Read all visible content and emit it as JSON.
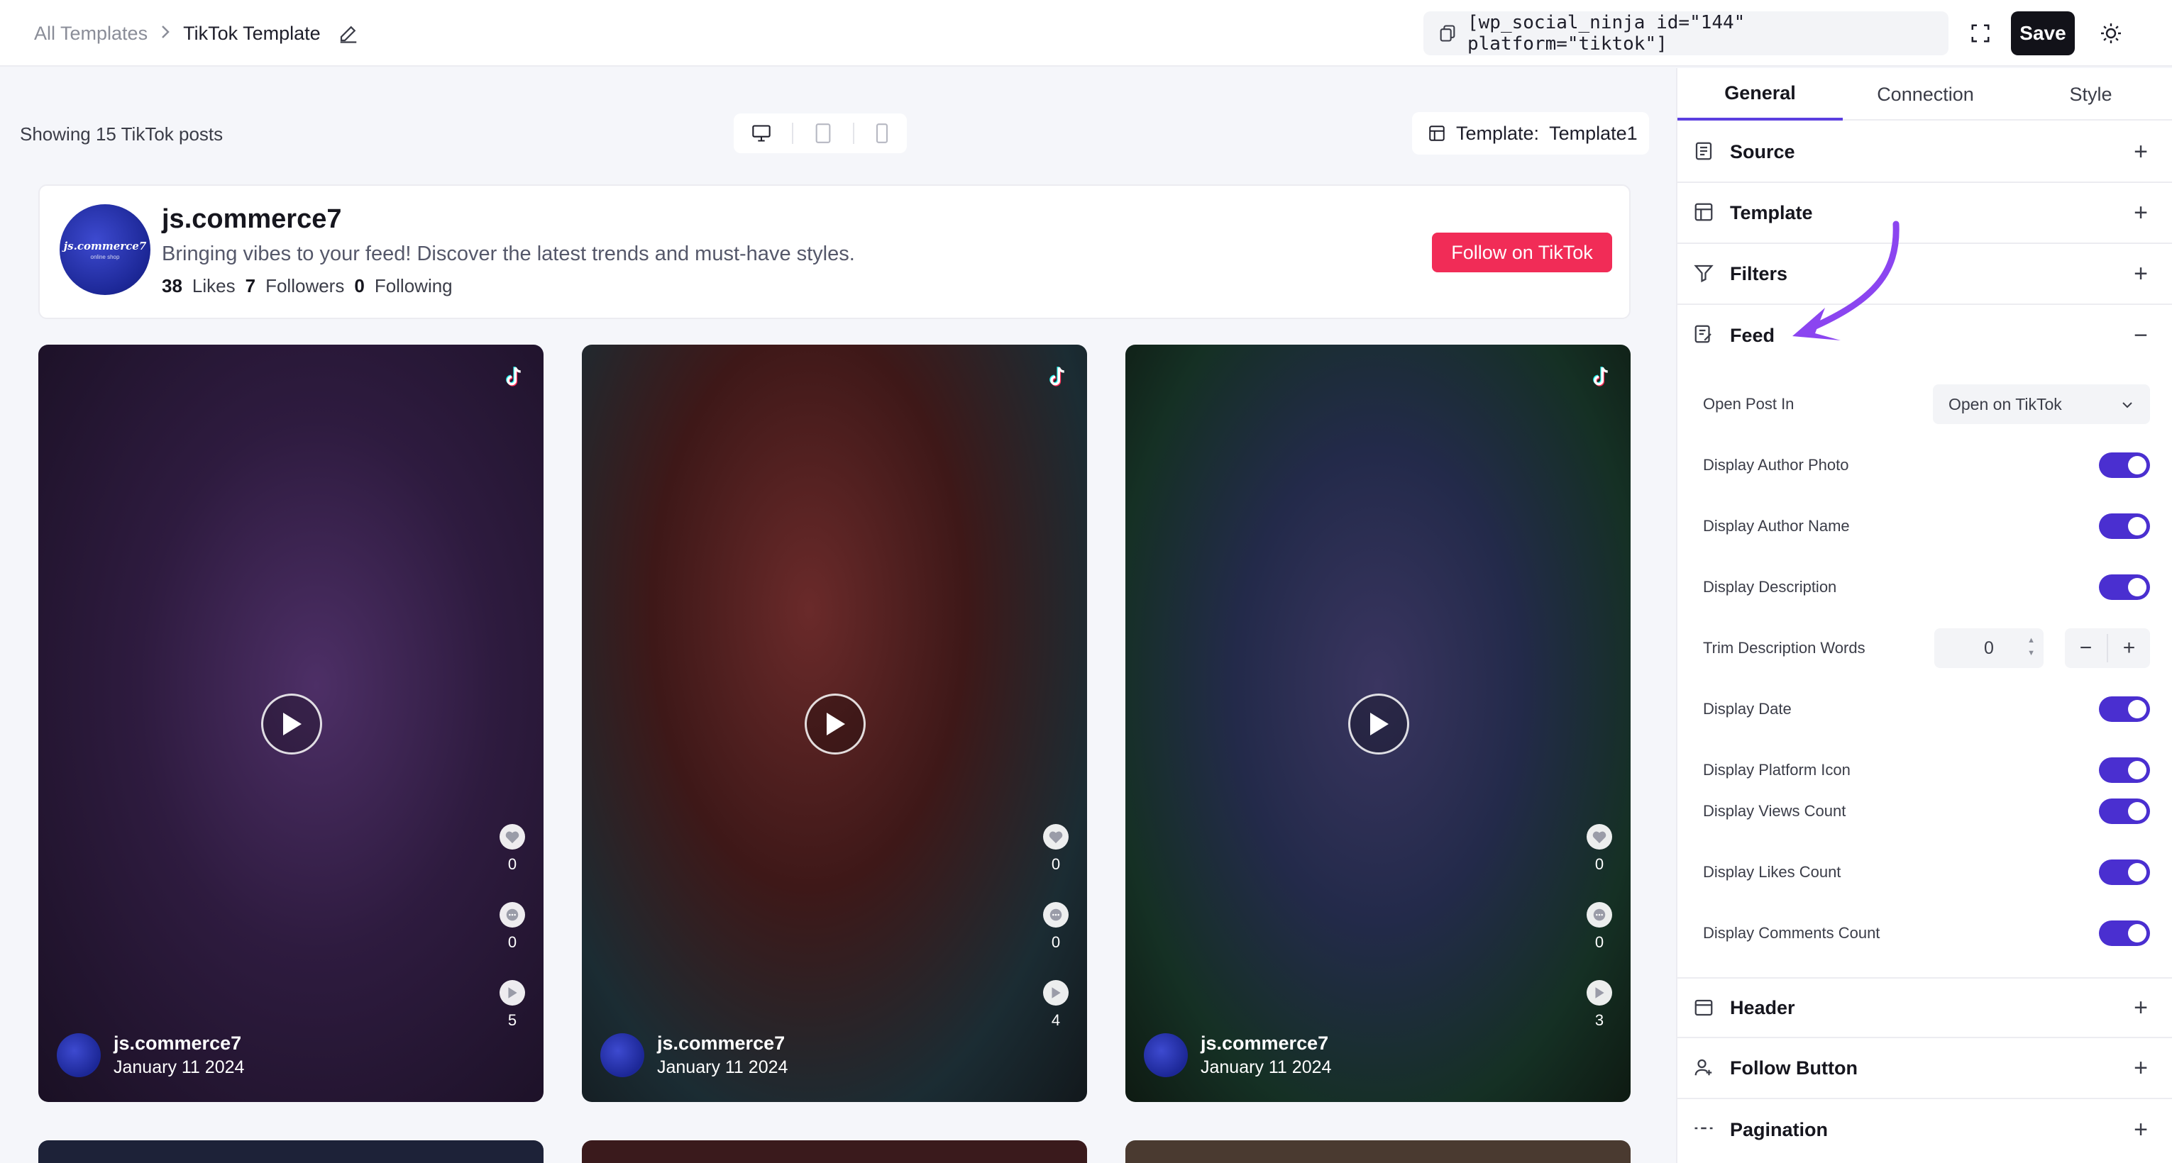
{
  "breadcrumb": {
    "root": "All Templates",
    "current": "TikTok Template"
  },
  "toolbar": {
    "shortcode": "[wp_social_ninja id=\"144\" platform=\"tiktok\"]",
    "save_label": "Save"
  },
  "preview": {
    "showing_text": "Showing 15 TikTok posts",
    "template_label": "Template:",
    "template_value": "Template1"
  },
  "profile": {
    "name": "js.commerce7",
    "avatar_text": "js.commerce7",
    "avatar_subtext": "online shop",
    "description": "Bringing vibes to your feed! Discover the latest trends and must-have styles.",
    "likes_count": "38",
    "likes_label": "Likes",
    "followers_count": "7",
    "followers_label": "Followers",
    "following_count": "0",
    "following_label": "Following",
    "follow_button": "Follow on TikTok"
  },
  "posts": [
    {
      "author": "js.commerce7",
      "date": "January 11 2024",
      "likes": "0",
      "comments": "0",
      "views": "5"
    },
    {
      "author": "js.commerce7",
      "date": "January 11 2024",
      "likes": "0",
      "comments": "0",
      "views": "4"
    },
    {
      "author": "js.commerce7",
      "date": "January 11 2024",
      "likes": "0",
      "comments": "0",
      "views": "3"
    }
  ],
  "panel": {
    "tabs": [
      "General",
      "Connection",
      "Style"
    ],
    "active_tab": "General",
    "sections": {
      "source": "Source",
      "template": "Template",
      "filters": "Filters",
      "feed": "Feed",
      "header": "Header",
      "follow_button": "Follow Button",
      "pagination": "Pagination"
    },
    "feed": {
      "open_post_in_label": "Open Post In",
      "open_post_in_value": "Open on TikTok",
      "display_author_photo": "Display Author Photo",
      "display_author_name": "Display Author Name",
      "display_description": "Display Description",
      "trim_description_words": "Trim Description Words",
      "trim_value": "0",
      "display_date": "Display Date",
      "display_platform_icon": "Display Platform Icon",
      "display_views_count": "Display Views Count",
      "display_likes_count": "Display Likes Count",
      "display_comments_count": "Display Comments Count"
    }
  },
  "colors": {
    "accent": "#4a2fd0",
    "tiktok": "#f12c57",
    "save": "#121219"
  }
}
